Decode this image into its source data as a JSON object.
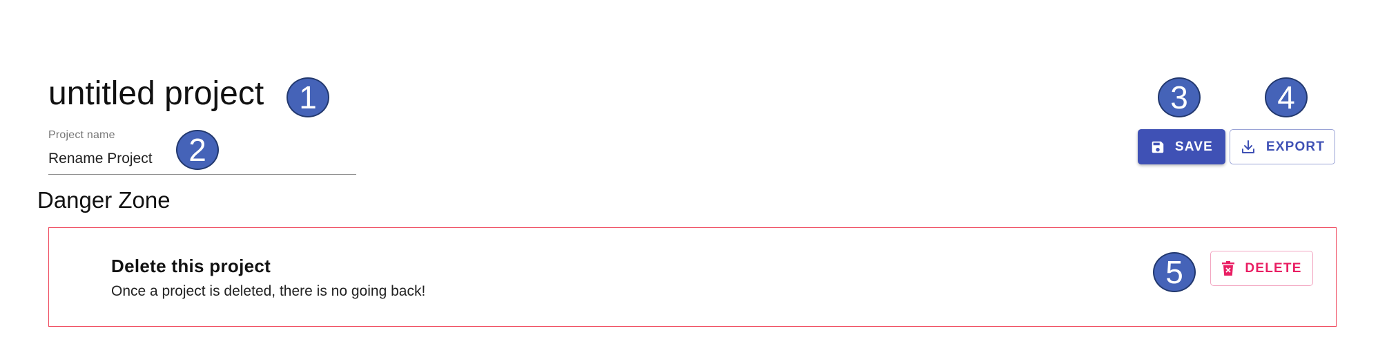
{
  "project": {
    "title": "untitled project",
    "name_field": {
      "label": "Project name",
      "value": "Rename Project"
    }
  },
  "toolbar": {
    "save_label": "SAVE",
    "save_icon": "floppy-disk-icon",
    "export_label": "EXPORT",
    "export_icon": "download-icon"
  },
  "danger_zone": {
    "heading": "Danger Zone",
    "delete_title": "Delete this project",
    "delete_description": "Once a project is deleted, there is no going back!",
    "delete_label": "DELETE",
    "delete_icon": "trash-icon"
  },
  "annotations": {
    "m1": "1",
    "m2": "2",
    "m3": "3",
    "m4": "4",
    "m5": "5"
  },
  "colors": {
    "primary": "#3f51b5",
    "danger_border": "#ef4a5e",
    "delete_accent": "#e91e63",
    "marker_fill": "#4563b8"
  }
}
